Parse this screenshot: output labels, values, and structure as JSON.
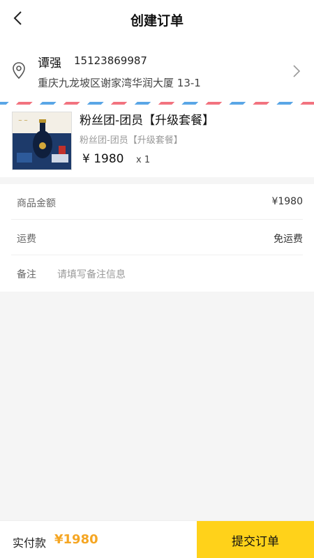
{
  "header": {
    "title": "创建订单",
    "back_icon": "chevron-left-icon"
  },
  "address": {
    "name": "谭强",
    "phone": "15123869987",
    "detail": "重庆九龙坡区谢家湾华润大厦 13-1",
    "location_icon": "location-pin-icon",
    "arrow_icon": "chevron-right-icon"
  },
  "product": {
    "title": "粉丝团-团员【升级套餐】",
    "subtitle": "粉丝团-团员【升级套餐】",
    "price": "¥ 1980",
    "quantity": "x 1"
  },
  "summary": {
    "goods_total_label": "商品金额",
    "goods_total_value": "¥1980",
    "shipping_label": "运费",
    "shipping_value": "免运费",
    "remark_label": "备注",
    "remark_placeholder": "请填写备注信息"
  },
  "footer": {
    "pay_label": "实付款",
    "pay_amount": "¥1980",
    "submit_label": "提交订单"
  },
  "colors": {
    "accent_yellow": "#ffd21a",
    "price_orange": "#f5a623",
    "stripe_red": "#f2737f",
    "stripe_blue": "#5aa6e6"
  }
}
